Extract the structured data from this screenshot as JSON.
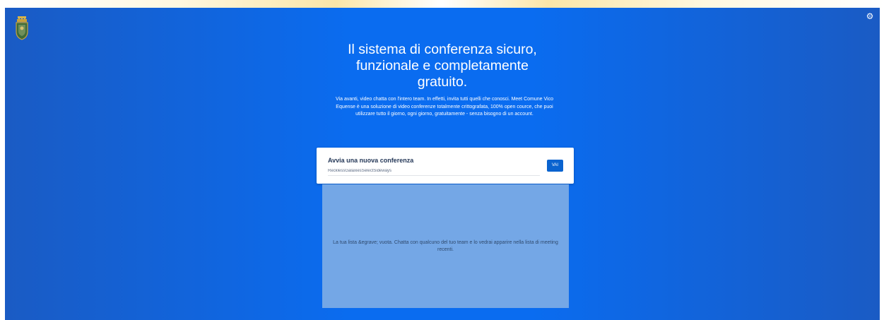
{
  "header": {
    "logo": "coat-of-arms",
    "settings_icon": "gear-icon"
  },
  "hero": {
    "title": "Il sistema di conferenza sicuro, funzionale e completamente gratuito.",
    "description": "Via avanti, video chatta con l'intero team. In effetti, invita tutti quelli che conosci. Meet Comune Vico Equense è una soluzione di video conferenze totalmente crittografata, 100% open cource, che puoi utilizzare tutto il giorno, ogni giorno, gratuitamente - senza bisogno di un account."
  },
  "conference": {
    "title": "Avvia una nuova conferenza",
    "room_name_value": "RecklessGalaxiesSelectSideways",
    "go_button_label": "VAI"
  },
  "recent": {
    "empty_message": "La tua lista &egrave; vuota. Chatta con qualcuno del tuo team e lo vedrai apparire nella lista di meeting recenti."
  },
  "colors": {
    "background": "#0a6cf0",
    "button": "#0a63cf",
    "panel": "#74a7e6"
  }
}
